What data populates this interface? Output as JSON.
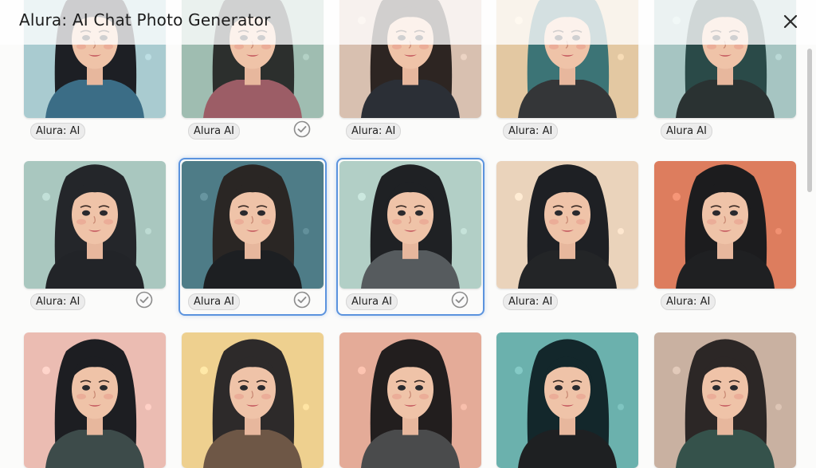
{
  "window": {
    "title": "Alura: AI Chat Photo Generator"
  },
  "icons": {
    "close": "close-icon",
    "check": "check-circle-icon"
  },
  "colors": {
    "selection_border": "#5b93de"
  },
  "rows": [
    {
      "cards": [
        {
          "label": "Alura: AI",
          "checked": false,
          "selected": false,
          "bg": "#a9cbd0",
          "hair": "#1d1f24",
          "top": "#3b6d86"
        },
        {
          "label": "Alura AI",
          "checked": true,
          "selected": false,
          "bg": "#9fbdb1",
          "hair": "#2c2f2d",
          "top": "#9c5d66"
        },
        {
          "label": "Alura: AI",
          "checked": false,
          "selected": false,
          "bg": "#d8c0b0",
          "hair": "#2d2522",
          "top": "#2b2f36"
        },
        {
          "label": "Alura: AI",
          "checked": false,
          "selected": false,
          "bg": "#e3c8a2",
          "hair": "#3c7476",
          "top": "#343638"
        },
        {
          "label": "Alura AI",
          "checked": false,
          "selected": false,
          "bg": "#a6c5c2",
          "hair": "#2a4a48",
          "top": "#2a3232"
        }
      ]
    },
    {
      "cards": [
        {
          "label": "Alura: AI",
          "checked": true,
          "selected": false,
          "bg": "#a9c7bf",
          "hair": "#24262a",
          "top": "#222428"
        },
        {
          "label": "Alura AI",
          "checked": true,
          "selected": true,
          "bg": "#4e7c87",
          "hair": "#2a2624",
          "top": "#1d1f22"
        },
        {
          "label": "Alura AI",
          "checked": true,
          "selected": true,
          "bg": "#b2cfc6",
          "hair": "#1f2124",
          "top": "#565b5e"
        },
        {
          "label": "Alura: AI",
          "checked": false,
          "selected": false,
          "bg": "#ead3bb",
          "hair": "#1e2024",
          "top": "#232527"
        },
        {
          "label": "Alura: AI",
          "checked": false,
          "selected": false,
          "bg": "#dd7d5e",
          "hair": "#1c1c1e",
          "top": "#1f2022"
        }
      ]
    },
    {
      "cards": [
        {
          "label": "",
          "checked": false,
          "selected": false,
          "bg": "#ebbcb2",
          "hair": "#1d1e22",
          "top": "#3d4b4a"
        },
        {
          "label": "",
          "checked": false,
          "selected": false,
          "bg": "#eed08f",
          "hair": "#2d2a2a",
          "top": "#6e5746"
        },
        {
          "label": "",
          "checked": false,
          "selected": false,
          "bg": "#e4ab98",
          "hair": "#221e1e",
          "top": "#4a4b4c"
        },
        {
          "label": "",
          "checked": false,
          "selected": false,
          "bg": "#6bb1ad",
          "hair": "#13272b",
          "top": "#1e2022"
        },
        {
          "label": "",
          "checked": false,
          "selected": false,
          "bg": "#c9b1a1",
          "hair": "#2c2726",
          "top": "#35524b"
        }
      ]
    }
  ]
}
